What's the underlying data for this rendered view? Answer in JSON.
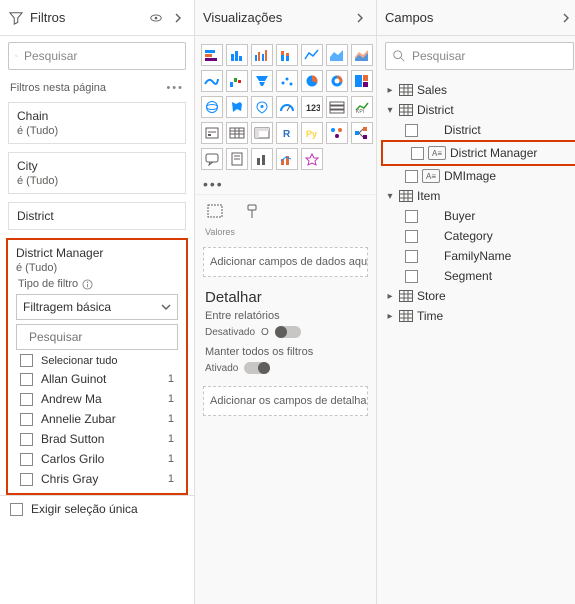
{
  "filters": {
    "title": "Filtros",
    "search_placeholder": "Pesquisar",
    "section_label": "Filtros nesta página",
    "cards": [
      {
        "name": "Chain",
        "sub": "é (Tudo)"
      },
      {
        "name": "City",
        "sub": "é (Tudo)"
      },
      {
        "name": "District",
        "sub": ""
      }
    ],
    "active": {
      "name": "District Manager",
      "sub": "é (Tudo)",
      "type_label": "Tipo de filtro",
      "type_value": "Filtragem básica",
      "search_placeholder": "Pesquisar",
      "select_all": "Selecionar tudo",
      "items": [
        {
          "label": "Allan Guinot",
          "count": "1"
        },
        {
          "label": "Andrew Ma",
          "count": "1"
        },
        {
          "label": "Annelie Zubar",
          "count": "1"
        },
        {
          "label": "Brad Sutton",
          "count": "1"
        },
        {
          "label": "Carlos Grilo",
          "count": "1"
        },
        {
          "label": "Chris Gray",
          "count": "1"
        }
      ],
      "require_single": "Exigir seleção única"
    }
  },
  "viz": {
    "title": "Visualizações",
    "values_label": "Valores",
    "values_well": "Adicionar campos de dados aqui",
    "drill_title": "Detalhar",
    "cross_report": "Entre relatórios",
    "cross_state": "Desativado",
    "keep_all": "Manter todos os filtros",
    "keep_state": "Ativado",
    "drill_well": "Adicionar os campos de detalhamento aqui"
  },
  "fields": {
    "title": "Campos",
    "search_placeholder": "Pesquisar",
    "tables": {
      "sales": "Sales",
      "district": "District",
      "district_children": [
        "District",
        "District Manager",
        "DMImage"
      ],
      "item": "Item",
      "item_children": [
        "Buyer",
        "Category",
        "FamilyName",
        "Segment"
      ],
      "store": "Store",
      "time": "Time"
    }
  }
}
